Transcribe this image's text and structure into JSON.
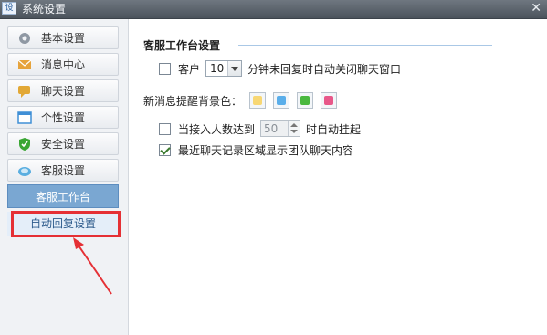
{
  "window": {
    "title": "系统设置",
    "app_icon": "window-icon"
  },
  "sidebar": {
    "items": [
      {
        "label": "基本设置",
        "icon": "gear-icon"
      },
      {
        "label": "消息中心",
        "icon": "envelope-icon"
      },
      {
        "label": "聊天设置",
        "icon": "chat-bubble-icon"
      },
      {
        "label": "个性设置",
        "icon": "window-panel-icon"
      },
      {
        "label": "安全设置",
        "icon": "shield-icon"
      },
      {
        "label": "客服设置",
        "icon": "headset-icon"
      }
    ],
    "sub_items": [
      {
        "label": "客服工作台",
        "state": "selected"
      },
      {
        "label": "自动回复设置",
        "state": "highlighted"
      }
    ]
  },
  "main": {
    "section_title": "客服工作台设置",
    "auto_close": {
      "checked": false,
      "prefix": "客户",
      "minutes": "10",
      "suffix": "分钟未回复时自动关闭聊天窗口"
    },
    "bg_color": {
      "label": "新消息提醒背景色：",
      "colors": [
        "#f7d774",
        "#5aaeea",
        "#49b83f",
        "#e8588a"
      ]
    },
    "auto_hangup": {
      "checked": false,
      "prefix": "当接入人数达到",
      "value": "50",
      "suffix": "时自动挂起"
    },
    "team_chat": {
      "checked": true,
      "label": "最近聊天记录区域显示团队聊天内容"
    }
  },
  "annotation": {
    "highlight_color": "#e53035"
  }
}
